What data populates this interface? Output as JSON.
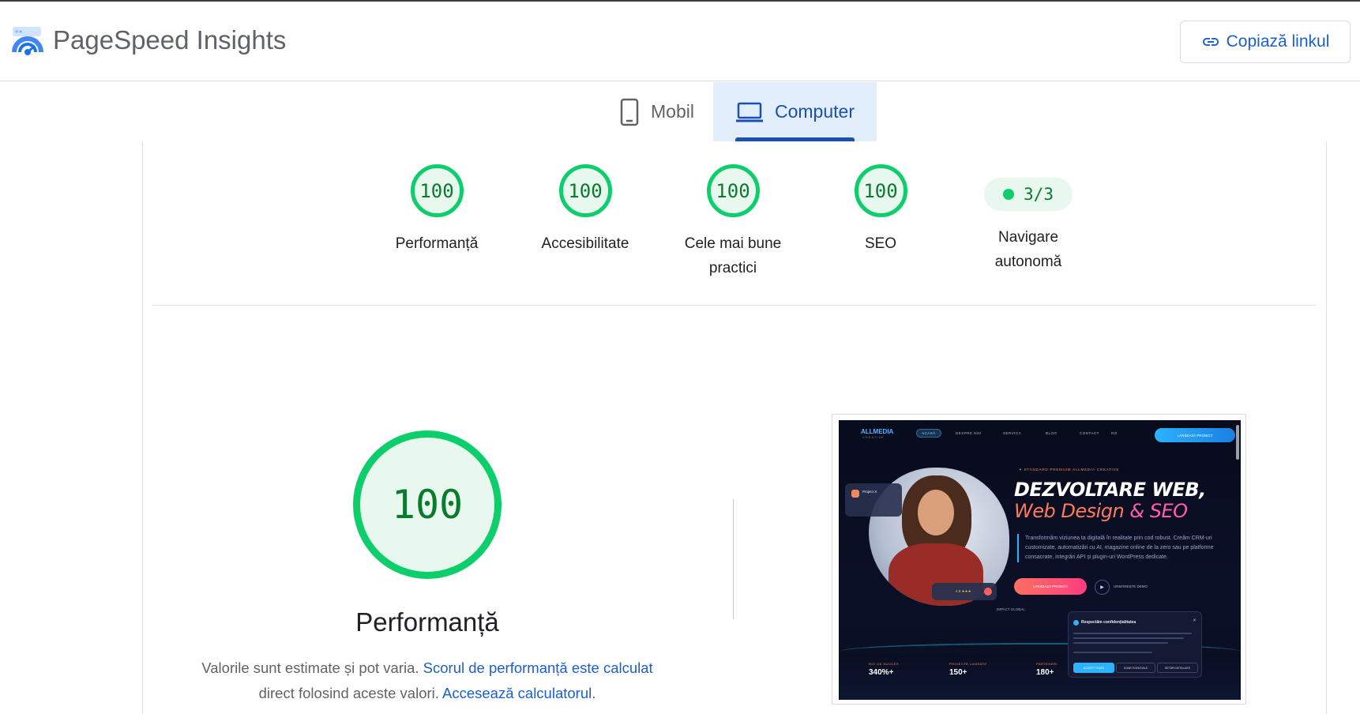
{
  "app": {
    "brand": "PageSpeed Insights"
  },
  "header": {
    "copy_link_label": "Copiază linkul"
  },
  "tabs": [
    {
      "label": "Mobil",
      "active": false
    },
    {
      "label": "Computer",
      "active": true
    }
  ],
  "scores": [
    {
      "value": "100",
      "label_line1": "Performanță",
      "label_line2": ""
    },
    {
      "value": "100",
      "label_line1": "Accesibilitate",
      "label_line2": ""
    },
    {
      "value": "100",
      "label_line1": "Cele mai bune",
      "label_line2": "practici"
    },
    {
      "value": "100",
      "label_line1": "SEO",
      "label_line2": ""
    }
  ],
  "agentic": {
    "value": "3/3",
    "label_line1": "Navigare",
    "label_line2": "autonomă"
  },
  "performance": {
    "score": "100",
    "title": "Performanță",
    "desc_prefix": "Valorile sunt estimate și pot varia. ",
    "desc_link1": "Scorul de performanță este calculat",
    "desc_mid": "direct folosind aceste valori. ",
    "desc_link2": "Accesează calculatorul",
    "desc_suffix": "."
  },
  "thumbnail": {
    "logo": "ALLMEDIA",
    "logo_sub": "CREATIVE",
    "nav": [
      "ACASĂ",
      "DESPRE NOI",
      "SERVICII",
      "BLOG",
      "CONTACT",
      "RO"
    ],
    "cta": "LANSEAZĂ PROIECT",
    "badge": "✦ STANDARD PREMIUM ALLMEDIA CREATIVE",
    "headline1": "DEZVOLTARE WEB,",
    "headline2a": "Web Design ",
    "headline2b": "& SEO",
    "paragraph": "Transformăm viziunea ta digitală în realitate prin cod robust. Creăm CRM-uri customizate, automatizări cu AI, magazine online de la zero sau pe platforme consacrate, integrări API și plugin-uri WordPress dedicate.",
    "btn_primary": "LANSEAZĂ PROIECT",
    "btn_secondary": "URMĂREȘTE DEMO",
    "card_title": "Project X",
    "rating": "4.9 ★★★",
    "impact": "IMPACT GLOBAL",
    "stats": [
      {
        "label": "ROI DE SUCCES",
        "value": "340%+"
      },
      {
        "label": "PROIECTE LANSATE",
        "value": "150+"
      },
      {
        "label": "PARTENERI",
        "value": "180+"
      }
    ],
    "cookie_title": "Respectăm confidențialitatea",
    "cookie_buttons": [
      "ACCEPT TOATE",
      "DOAR ESENȚIALE",
      "SETĂRI DETALIATE"
    ]
  },
  "colors": {
    "pass": "#0cce6b",
    "pass_bg": "#e9f8ef",
    "link": "#1a5fd0",
    "tab_active_bg": "#e3eefc"
  },
  "icons": {
    "logo": "pagespeed-logo-icon",
    "copy": "link-icon",
    "mobile": "phone-icon",
    "desktop": "laptop-icon"
  }
}
